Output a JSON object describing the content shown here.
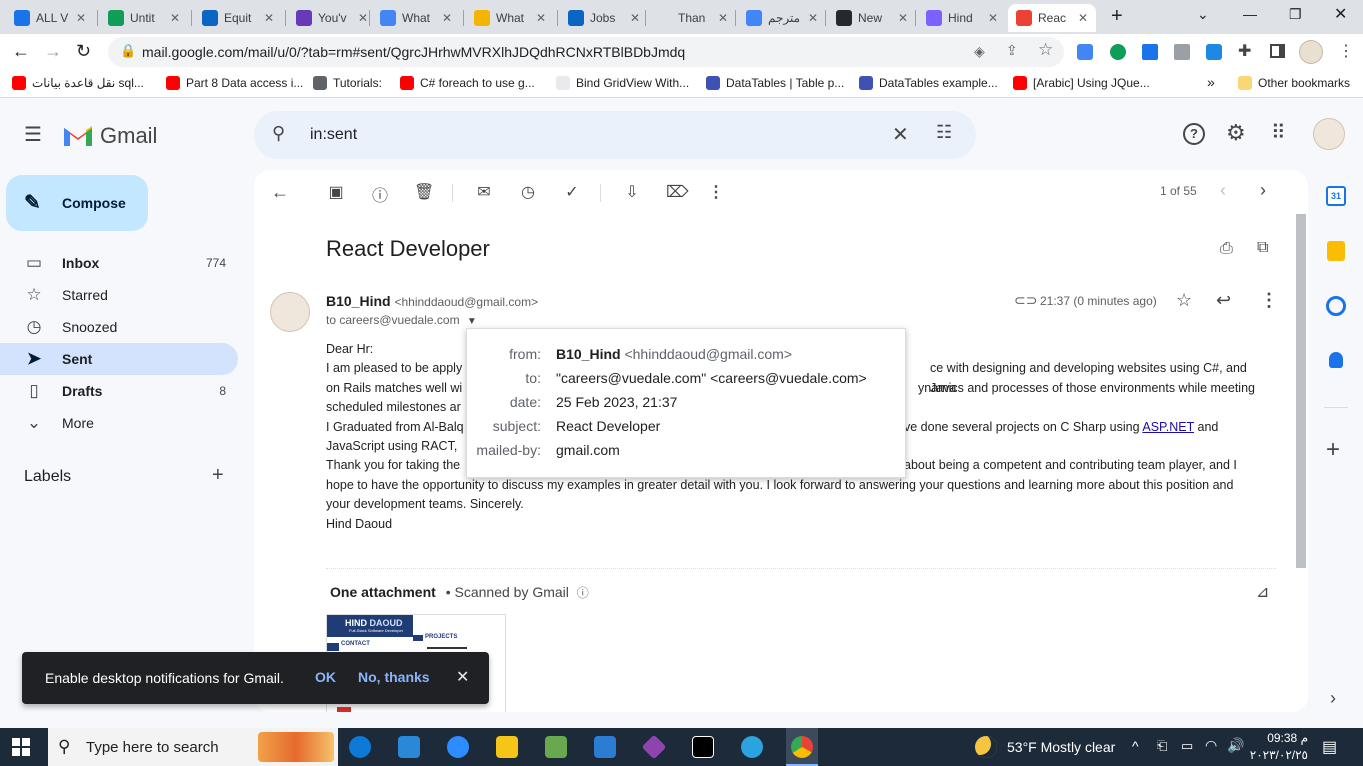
{
  "browser": {
    "tabs": [
      {
        "title": "ALL V",
        "favicon": "google-drive-icon",
        "color": "#1a73e8"
      },
      {
        "title": "Untit",
        "favicon": "google-sheets-icon",
        "color": "#0f9d58"
      },
      {
        "title": "Equit",
        "favicon": "linkedin-icon",
        "color": "#0a66c2"
      },
      {
        "title": "You'v",
        "favicon": "forms-icon",
        "color": "#673ab7"
      },
      {
        "title": "What",
        "favicon": "google-icon",
        "color": "#4285f4"
      },
      {
        "title": "What",
        "favicon": "bing-icon",
        "color": "#f4b400"
      },
      {
        "title": "Jobs",
        "favicon": "linkedin-icon",
        "color": "#0a66c2"
      },
      {
        "title": "Than",
        "favicon": "blank-icon",
        "color": "#dee1e6"
      },
      {
        "title": "مترجم",
        "favicon": "google-icon",
        "color": "#4285f4"
      },
      {
        "title": "New",
        "favicon": "github-icon",
        "color": "#24292e"
      },
      {
        "title": "Hind",
        "favicon": "canva-icon",
        "color": "#7b61ff"
      },
      {
        "title": "Reac",
        "favicon": "gmail-icon",
        "color": "#ea4335"
      }
    ],
    "url": "mail.google.com/mail/u/0/?tab=rm#sent/QgrcJHrhwMVRXlhJDQdhRCNxRTBlBDbJmdq",
    "bookmarks": [
      {
        "label": "نقل قاعدة بيانات sql...",
        "color": "#ff0000"
      },
      {
        "label": "Part 8 Data access i...",
        "color": "#ff0000"
      },
      {
        "label": "Tutorials:",
        "color": "#5f6368"
      },
      {
        "label": "C# foreach to use g...",
        "color": "#ff0000"
      },
      {
        "label": "Bind GridView With...",
        "color": "#e8eaed"
      },
      {
        "label": "DataTables | Table p...",
        "color": "#3f51b5"
      },
      {
        "label": "DataTables example...",
        "color": "#3f51b5"
      },
      {
        "label": "[Arabic] Using JQue...",
        "color": "#ff0000"
      }
    ],
    "more_bookmarks": "»",
    "other_bookmarks": "Other bookmarks"
  },
  "gmail": {
    "logo_text": "Gmail",
    "search_value": "in:sent",
    "compose_label": "Compose",
    "nav": [
      {
        "label": "Inbox",
        "count": "774",
        "icon": "inbox-icon",
        "glyph": "▭"
      },
      {
        "label": "Starred",
        "count": "",
        "icon": "star-icon",
        "glyph": "☆"
      },
      {
        "label": "Snoozed",
        "count": "",
        "icon": "clock-icon",
        "glyph": "◷"
      },
      {
        "label": "Sent",
        "count": "",
        "icon": "send-icon",
        "glyph": "➤"
      },
      {
        "label": "Drafts",
        "count": "8",
        "icon": "draft-icon",
        "glyph": "▯"
      },
      {
        "label": "More",
        "count": "",
        "icon": "chevron-down-icon",
        "glyph": "⌄"
      }
    ],
    "labels_heading": "Labels",
    "pager": "1 of 55",
    "subject": "React Developer",
    "sender_name": "B10_Hind",
    "sender_email": "<hhinddaoud@gmail.com>",
    "to_line": "to careers@vuedale.com",
    "time": "21:37 (0 minutes ago)",
    "body": {
      "greeting": "Dear Hr:",
      "p1a": "I am pleased to be apply",
      "p1b": "ce with designing and developing websites using C#, and Java",
      "p2a": "on Rails matches well wi",
      "p2b": "ynamics and processes of those environments while meeting",
      "p3a": "scheduled milestones ar",
      "p4a": "I Graduated from Al-Balq",
      "p4b": "ve done several projects on C Sharp using",
      "p4link": "ASP.NET",
      "p4c": "and",
      "p5a": "JavaScript using RACT,",
      "p6a": " Thank you for taking the",
      "p6b": "about being a competent and contributing team player, and I",
      "p7": "hope to have the opportunity to discuss my examples in greater detail with you. I look forward to answering your questions and learning more about this position and",
      "p8": "your development teams. Sincerely.",
      "signature": "Hind Daoud"
    },
    "attachment_heading": "One attachment",
    "scanned": "• Scanned by Gmail",
    "attachment_preview": {
      "name_a": "HIND",
      "name_b": "DAOUD",
      "tagline": "Full-Stack Software Developer",
      "projects": "PROJECTS",
      "contact": "CONTACT"
    }
  },
  "popup": {
    "from_label": "from:",
    "from_name": "B10_Hind",
    "from_email": "<hhinddaoud@gmail.com>",
    "to_label": "to:",
    "to_value": "\"careers@vuedale.com\" <careers@vuedale.com>",
    "date_label": "date:",
    "date_value": "25 Feb 2023, 21:37",
    "subject_label": "subject:",
    "subject_value": "React Developer",
    "mailedby_label": "mailed-by:",
    "mailedby_value": "gmail.com"
  },
  "snackbar": {
    "message": "Enable desktop notifications for Gmail.",
    "ok": "OK",
    "no": "No, thanks"
  },
  "taskbar": {
    "search_placeholder": "Type here to search",
    "weather": "53°F  Mostly clear",
    "time": "09:38 م",
    "date": "٢٠٢٣/٠٢/٢٥"
  }
}
